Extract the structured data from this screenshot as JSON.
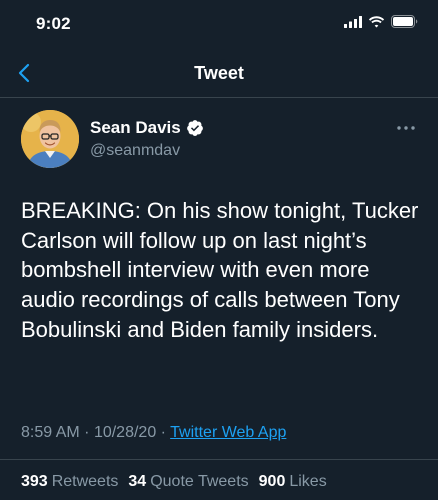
{
  "status_bar": {
    "time": "9:02"
  },
  "nav": {
    "title": "Tweet"
  },
  "tweet": {
    "author_name": "Sean Davis",
    "author_handle": "@seanmdav",
    "verified": true,
    "text": "BREAKING: On his show tonight, Tucker Carlson will follow up on last night’s bombshell interview with even more audio recordings of calls between Tony Bobulinski and Biden family insiders.",
    "time": "8:59 AM",
    "date": "10/28/20",
    "separator": "·",
    "source": "Twitter Web App"
  },
  "stats": {
    "retweets_count": "393",
    "retweets_label": "Retweets",
    "quotes_count": "34",
    "quotes_label": "Quote Tweets",
    "likes_count": "900",
    "likes_label": "Likes"
  },
  "colors": {
    "background": "#15202b",
    "accent": "#1da1f2",
    "secondary_text": "#8899a6",
    "divider": "#38444d"
  },
  "icons": {
    "back": "chevron-left-icon",
    "verified": "verified-badge-icon",
    "more": "ellipsis-icon",
    "signal": "cellular-signal-icon",
    "wifi": "wifi-icon",
    "battery": "battery-icon"
  }
}
